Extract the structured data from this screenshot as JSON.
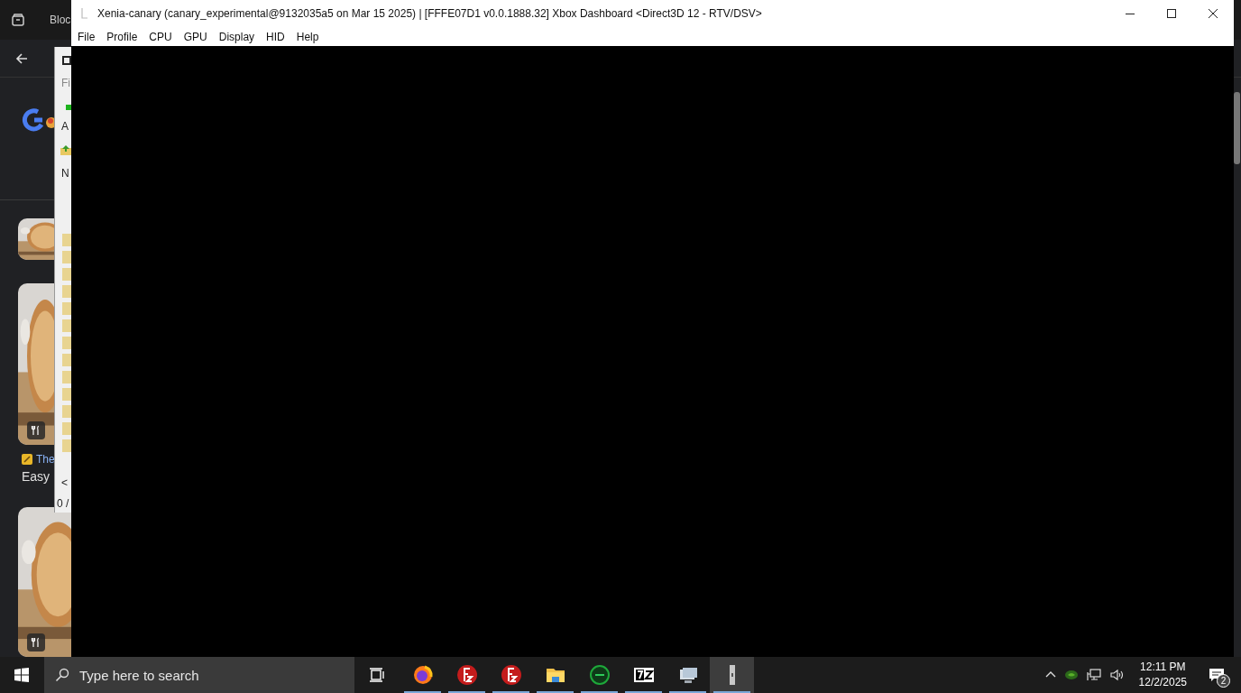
{
  "browser": {
    "tab_title": "Bloc",
    "cards": [
      {
        "kind": "picture"
      },
      {
        "kind": "picture",
        "badge": true,
        "source": "The",
        "title": "Easy"
      },
      {
        "kind": "picture",
        "badge": true
      }
    ]
  },
  "back_window": {
    "texts": [
      "Fi",
      "A",
      "N"
    ],
    "scroll_left": "<",
    "status": "0 /"
  },
  "window": {
    "title": "Xenia-canary (canary_experimental@9132035a5 on Mar 15 2025) | [FFFE07D1 v0.0.1888.32] Xbox Dashboard <Direct3D 12 - RTV/DSV>",
    "menu": [
      "File",
      "Profile",
      "CPU",
      "GPU",
      "Display",
      "HID",
      "Help"
    ]
  },
  "taskbar": {
    "search": {
      "placeholder": "Type here to search"
    },
    "apps": [
      {
        "kind": "firefox",
        "running": true,
        "selected": false
      },
      {
        "kind": "filezilla",
        "running": true,
        "selected": false
      },
      {
        "kind": "filezilla",
        "running": true,
        "selected": false
      },
      {
        "kind": "folder",
        "running": true,
        "selected": false
      },
      {
        "kind": "ring",
        "running": true,
        "selected": false
      },
      {
        "kind": "sevenzip",
        "running": true,
        "selected": false
      },
      {
        "kind": "network",
        "running": true,
        "selected": false
      },
      {
        "kind": "xenia",
        "running": true,
        "selected": true
      }
    ],
    "time": "12:11 PM",
    "date": "12/2/2025",
    "notifications": "2"
  }
}
